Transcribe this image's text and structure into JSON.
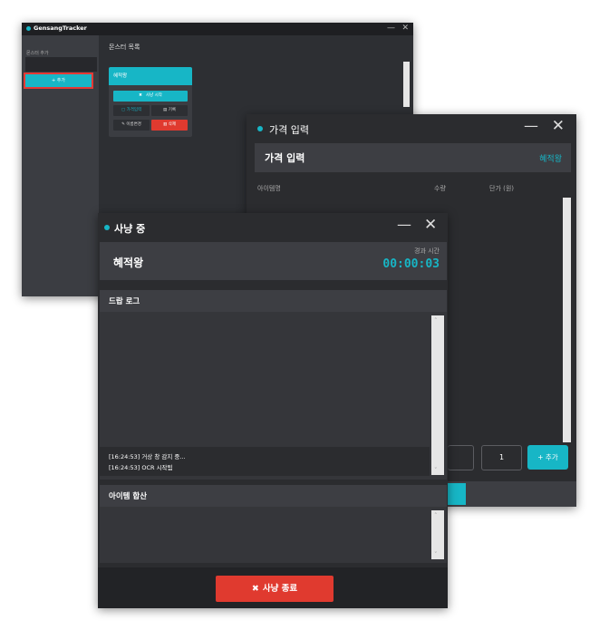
{
  "main_window": {
    "title": "GensangTracker",
    "minimize_icon": "minimize-icon",
    "close_icon": "close-icon",
    "sidebar": {
      "label": "몬스터 추가",
      "input_value": "",
      "add_button": "+ 추가"
    },
    "content_title": "몬스터 목록",
    "monster_card": {
      "name": "혜적왕",
      "start_button": "사냥 시작",
      "button2": "가격입력",
      "button3": "기록",
      "button4": "이름변경",
      "delete_button": "삭제"
    }
  },
  "price_window": {
    "title": "가격 입력",
    "header_title": "가격 입력",
    "monster_name": "혜적왕",
    "columns": {
      "item_name": "아이템명",
      "quantity": "수량",
      "unit_price": "단가 (원)"
    },
    "quantity_value": "1",
    "add_button": "+ 추가"
  },
  "hunt_window": {
    "title": "사냥 중",
    "monster_name": "혜적왕",
    "elapsed_label": "경과 시간",
    "elapsed_time": "00:00:03",
    "drop_log_title": "드랍 로그",
    "log_lines": [
      "[16:24:53] 거상 창 감지 중...",
      "[16:24:53] OCR 시작됨"
    ],
    "item_sum_title": "아이템 합산",
    "stop_button": "사냥 종료"
  },
  "colors": {
    "accent": "#17b6c6",
    "danger": "#e03a2f",
    "background": "#2b2c2f",
    "panel": "#3d3e43"
  }
}
